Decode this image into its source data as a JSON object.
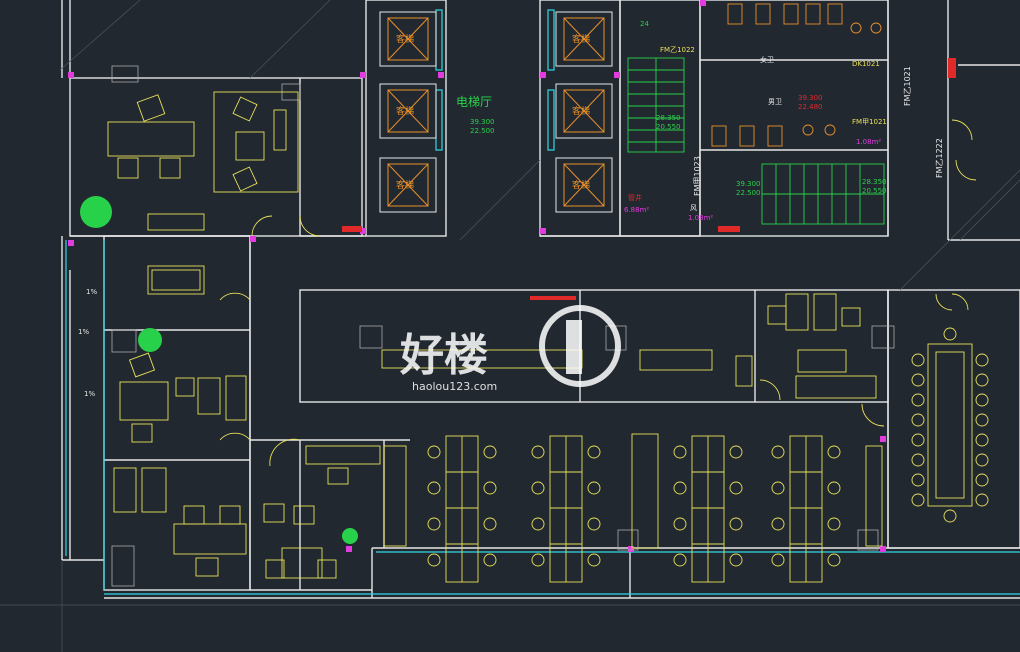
{
  "plan": {
    "background": "#212830",
    "colors": {
      "wall": "#e6e6e6",
      "furniture": "#e8e05a",
      "cyan": "#2fd8e6",
      "magenta": "#e23ce0",
      "green": "#28d14a",
      "red": "#e02a2a",
      "orange": "#e8902c",
      "grid": "#4a5560"
    },
    "labels": {
      "elevator_hall": "电梯厅",
      "elevator_hall_dims": [
        "39.300",
        "22.500"
      ],
      "passenger_elevator": "客梯",
      "stair_dims": [
        "28.350",
        "20.550"
      ],
      "stair_dims_2": [
        "39.300",
        "22.500"
      ],
      "stair_dims_3": [
        "28.350",
        "20.550"
      ],
      "fire_door": "FM乙1022",
      "fire_door_2": "FM乙1021",
      "fire_door_3": "FM甲1021",
      "vertical_door": "FM甲1023",
      "vertical_door_2": "FM乙1222",
      "women_wc": "女卫",
      "men_wc": "男卫",
      "wc_dims": [
        "39.300",
        "22.480"
      ],
      "shaft": "管井",
      "shaft_area": "6.88m²",
      "dk": "DK1021",
      "pipe": "风",
      "pipe_area": "1.08m²",
      "pipe_area_2": "1.08m²",
      "counts_24": "24",
      "ui": "1%",
      "watermark": "好楼",
      "watermark_url": "haolou123.com"
    }
  }
}
